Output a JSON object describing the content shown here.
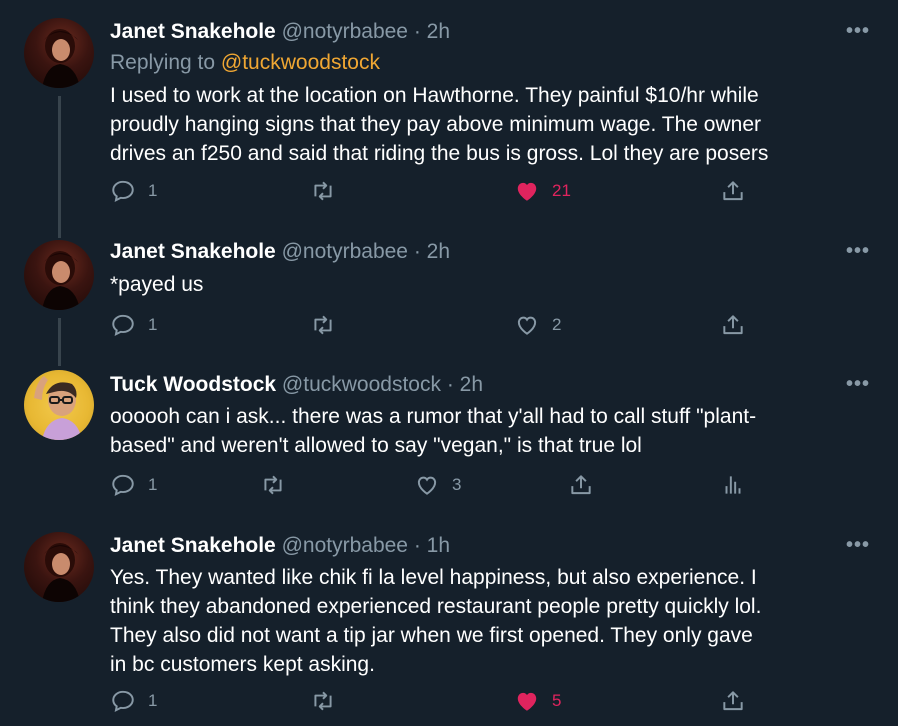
{
  "tweets": [
    {
      "name": "Janet Snakehole",
      "handle": "@notyrbabee",
      "time": "2h",
      "replying_prefix": "Replying to",
      "replying_mention": "@tuckwoodstock",
      "lines": [
        "I used to work at the location on Hawthorne. They painful $10/hr while",
        "proudly hanging signs that they pay above minimum wage. The owner",
        "drives an f250 and said that riding the bus is gross. Lol they are posers"
      ],
      "replies": "1",
      "likes": "21",
      "liked": true
    },
    {
      "name": "Janet Snakehole",
      "handle": "@notyrbabee",
      "time": "2h",
      "lines": [
        "*payed us"
      ],
      "replies": "1",
      "likes": "2",
      "liked": false
    },
    {
      "name": "Tuck Woodstock",
      "handle": "@tuckwoodstock",
      "time": "2h",
      "lines": [
        "oooooh can i ask... there was a rumor that y'all had to call stuff \"plant-",
        "based\" and weren't allowed to say \"vegan,\" is that true lol"
      ],
      "replies": "1",
      "likes": "3",
      "liked": false
    },
    {
      "name": "Janet Snakehole",
      "handle": "@notyrbabee",
      "time": "1h",
      "lines": [
        "Yes. They wanted like chik fi la level happiness, but also experience. I",
        "think they abandoned experienced restaurant people pretty quickly lol.",
        "They also did not want a tip jar when we first opened. They only gave",
        "in bc customers kept asking."
      ],
      "replies": "1",
      "likes": "5",
      "liked": true
    }
  ],
  "separator": "·",
  "more_glyph": "•••",
  "colors": {
    "background": "#15202b",
    "secondary_text": "#8899a6",
    "like": "#e0245e",
    "mention": "#f0a733",
    "thread_line": "#38444d"
  }
}
